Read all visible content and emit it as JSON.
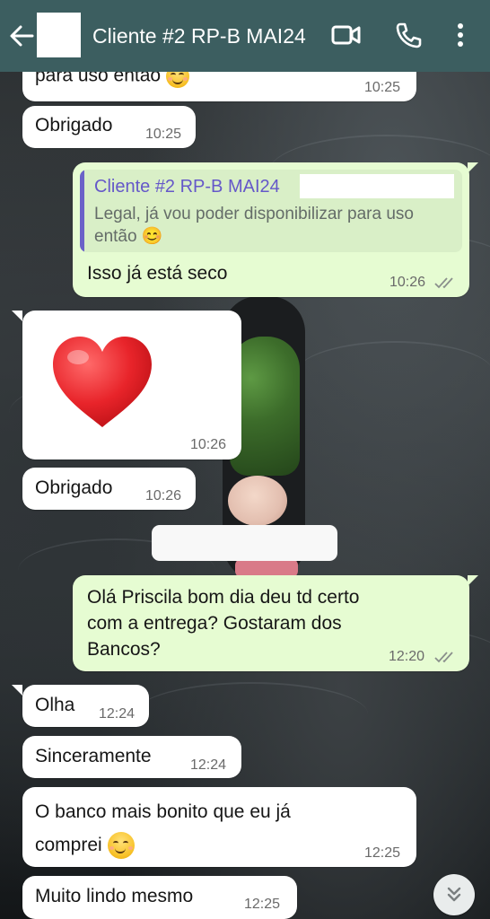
{
  "header": {
    "title": "Cliente #2 RP-B MAI24",
    "back_icon": "arrow-left-icon",
    "video_icon": "video-call-icon",
    "phone_icon": "phone-icon",
    "menu_icon": "more-vertical-icon",
    "background_color": "#3c5e60"
  },
  "messages": [
    {
      "id": "m1",
      "direction": "incoming",
      "text": "para uso então",
      "emoji": "smiling-face",
      "time": "10:25"
    },
    {
      "id": "m2",
      "direction": "incoming",
      "text": "Obrigado",
      "time": "10:25"
    },
    {
      "id": "m3",
      "direction": "outgoing",
      "quoted_author": "Cliente #2 RP-B MAI24",
      "quoted_text": "Legal, já vou poder disponibilizar para uso então 😊",
      "text": "Isso já está seco",
      "time": "10:26",
      "status": "read-ticks"
    },
    {
      "id": "m4",
      "direction": "incoming",
      "type": "emoji",
      "emoji": "red-heart",
      "time": "10:26"
    },
    {
      "id": "m5",
      "direction": "incoming",
      "text": "Obrigado",
      "time": "10:26"
    },
    {
      "id": "m6",
      "direction": "outgoing",
      "lines": [
        "Olá Priscila bom dia deu td certo",
        "com a entrega? Gostaram dos",
        "Bancos?"
      ],
      "time": "12:20",
      "status": "read-ticks"
    },
    {
      "id": "m7",
      "direction": "incoming",
      "text": "Olha",
      "time": "12:24"
    },
    {
      "id": "m8",
      "direction": "incoming",
      "text": "Sinceramente",
      "time": "12:24"
    },
    {
      "id": "m9",
      "direction": "incoming",
      "lines": [
        "O banco mais bonito que eu já",
        "comprei"
      ],
      "emoji": "smiling-face",
      "time": "12:25"
    },
    {
      "id": "m10",
      "direction": "incoming",
      "text": "Muito lindo mesmo",
      "time": "12:25"
    }
  ],
  "scroll_button_icon": "chevrons-down-icon",
  "colors": {
    "incoming_bubble": "#ffffff",
    "outgoing_bubble": "#e6fcd2",
    "quote_accent": "#6b62c8",
    "read_ticks": "#8a8f8c"
  }
}
